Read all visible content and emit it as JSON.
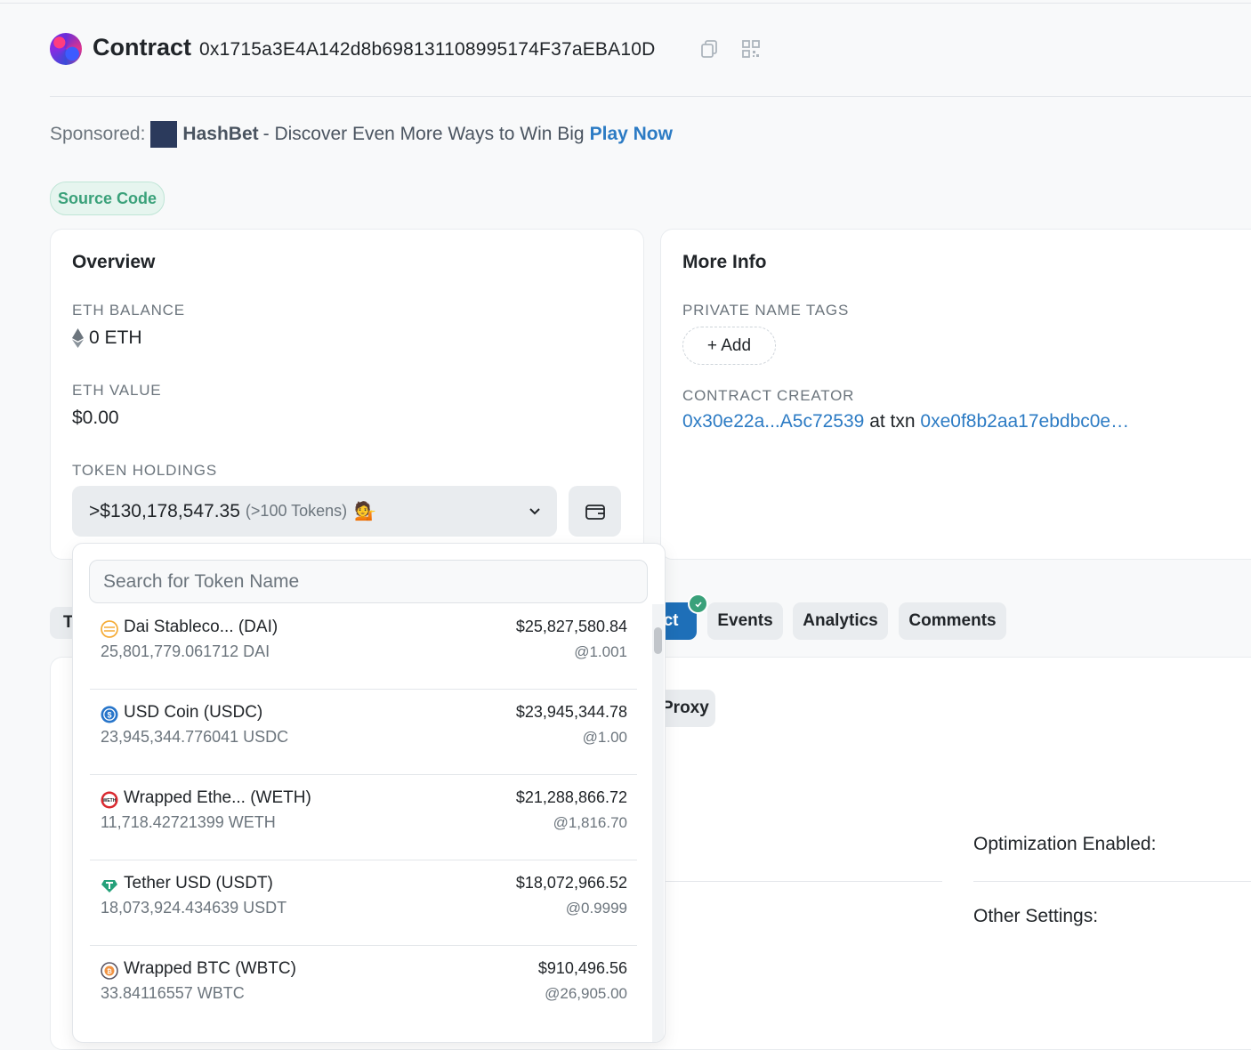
{
  "header": {
    "title": "Contract",
    "address": "0x1715a3E4A142d8b698131108995174F37aEBA10D"
  },
  "sponsored": {
    "prefix": "Sponsored:",
    "brand": "HashBet",
    "description": "- Discover Even More Ways to Win Big",
    "cta": "Play Now"
  },
  "badge": {
    "label": "Source Code"
  },
  "overview": {
    "title": "Overview",
    "eth_balance_label": "ETH BALANCE",
    "eth_balance": "0 ETH",
    "eth_value_label": "ETH VALUE",
    "eth_value": "$0.00",
    "token_holdings_label": "TOKEN HOLDINGS",
    "token_holdings_amount": ">$130,178,547.35",
    "token_holdings_count": "(>100 Tokens)",
    "token_holdings_emoji": "💁"
  },
  "more_info": {
    "title": "More Info",
    "private_tags_label": "PRIVATE NAME TAGS",
    "add_label": "+ Add",
    "creator_label": "CONTRACT CREATOR",
    "creator_address": "0x30e22a...A5c72539",
    "creator_connector": "at txn",
    "creator_txn": "0xe0f8b2aa17ebdbc0e…"
  },
  "tabs": {
    "first_partial": "T",
    "active_partial": "act",
    "events": "Events",
    "analytics": "Analytics",
    "comments": "Comments"
  },
  "contract_panel": {
    "proxy_partial": "Proxy",
    "optimization_label": "Optimization Enabled:",
    "other_settings_label": "Other Settings:"
  },
  "dropdown": {
    "search_placeholder": "Search for Token Name",
    "tokens": [
      {
        "name": "Dai Stableco... (DAI)",
        "quantity": "25,801,779.061712 DAI",
        "usd": "$25,827,580.84",
        "price": "@1.001",
        "icon": "dai-icon",
        "color": "#f5ac37"
      },
      {
        "name": "USD Coin (USDC)",
        "quantity": "23,945,344.776041 USDC",
        "usd": "$23,945,344.78",
        "price": "@1.00",
        "icon": "usdc-icon",
        "color": "#2775ca"
      },
      {
        "name": "Wrapped Ethe... (WETH)",
        "quantity": "11,718.42721399 WETH",
        "usd": "$21,288,866.72",
        "price": "@1,816.70",
        "icon": "weth-icon",
        "color": "#d9292f"
      },
      {
        "name": "Tether USD (USDT)",
        "quantity": "18,073,924.434639 USDT",
        "usd": "$18,072,966.52",
        "price": "@0.9999",
        "icon": "usdt-icon",
        "color": "#26a17b"
      },
      {
        "name": "Wrapped BTC (WBTC)",
        "quantity": "33.84116557 WBTC",
        "usd": "$910,496.56",
        "price": "@26,905.00",
        "icon": "wbtc-icon",
        "color": "#f09242"
      }
    ]
  }
}
